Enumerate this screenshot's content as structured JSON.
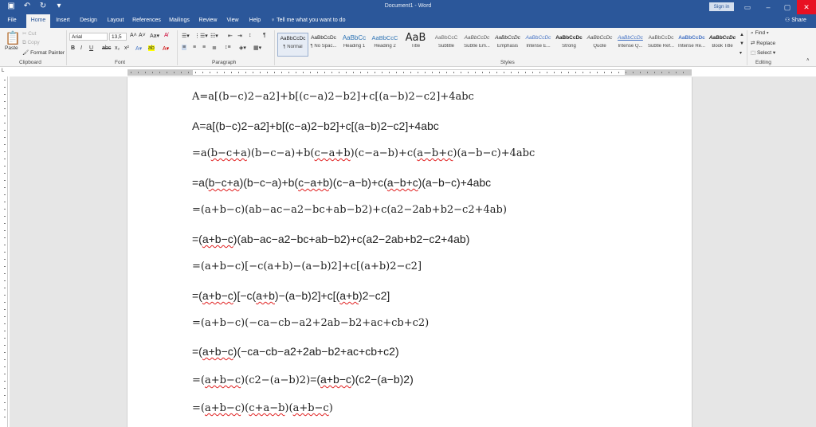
{
  "app": {
    "title": "Document1  -  Word",
    "signin": "Sign in",
    "share": "Share",
    "tell_me": "Tell me what you want to do"
  },
  "tabs": [
    "File",
    "Home",
    "Insert",
    "Design",
    "Layout",
    "References",
    "Mailings",
    "Review",
    "View",
    "Help"
  ],
  "ribbon": {
    "clipboard": {
      "label": "Clipboard",
      "paste": "Paste",
      "cut": "Cut",
      "copy": "Copy",
      "format_painter": "Format Painter"
    },
    "font": {
      "label": "Font",
      "font_name": "Arial",
      "font_size": "13,5"
    },
    "paragraph": {
      "label": "Paragraph"
    },
    "styles": {
      "label": "Styles",
      "items": [
        {
          "preview": "AaBbCcDc",
          "name": "¶ Normal"
        },
        {
          "preview": "AaBbCcDc",
          "name": "¶ No Spac..."
        },
        {
          "preview": "AaBbCc",
          "name": "Heading 1"
        },
        {
          "preview": "AaBbCcC",
          "name": "Heading 2"
        },
        {
          "preview": "AaB",
          "name": "Title"
        },
        {
          "preview": "AaBbCcC",
          "name": "Subtitle"
        },
        {
          "preview": "AaBbCcDc",
          "name": "Subtle Em..."
        },
        {
          "preview": "AaBbCcDc",
          "name": "Emphasis"
        },
        {
          "preview": "AaBbCcDc",
          "name": "Intense E..."
        },
        {
          "preview": "AaBbCcDc",
          "name": "Strong"
        },
        {
          "preview": "AaBbCcDc",
          "name": "Quote"
        },
        {
          "preview": "AaBbCcDc",
          "name": "Intense Q..."
        },
        {
          "preview": "AaBbCcDc",
          "name": "Subtle Ref..."
        },
        {
          "preview": "AaBbCcDc",
          "name": "Intense Re..."
        },
        {
          "preview": "AaBbCcDc",
          "name": "Book Title"
        }
      ]
    },
    "editing": {
      "label": "Editing",
      "find": "Find",
      "replace": "Replace",
      "select": "Select"
    }
  },
  "document": {
    "lines": [
      {
        "text": "A=a[(b−c)2−a2]+b[(c−a)2−b2]+c[(a−b)2−c2]+4abc"
      },
      {
        "text": "A=a[(b−c)2−a2]+b[(c−a)2−b2]+c[(a−b)2−c2]+4abc"
      },
      {
        "text": "=a(b−c+a)(b−c−a)+b(c−a+b)(c−a−b)+c(a−b+c)(a−b−c)+4abc"
      },
      {
        "text": "=a(b−c+a)(b−c−a)+b(c−a+b)(c−a−b)+c(a−b+c)(a−b−c)+4abc"
      },
      {
        "text": "=(a+b−c)(ab−ac−a2−bc+ab−b2)+c(a2−2ab+b2−c2+4ab)"
      },
      {
        "text": "=(a+b−c)(ab−ac−a2−bc+ab−b2)+c(a2−2ab+b2−c2+4ab)"
      },
      {
        "text": "=(a+b−c)[−c(a+b)−(a−b)2]+c[(a+b)2−c2]"
      },
      {
        "text": "=(a+b−c)[−c(a+b)−(a−b)2]+c[(a+b)2−c2]"
      },
      {
        "text": "=(a+b−c)(−ca−cb−a2+2ab−b2+ac+cb+c2)"
      },
      {
        "text": "=(a+b−c)(−ca−cb−a2+2ab−b2+ac+cb+c2)"
      },
      {
        "text": "=(a+b−c)(c2−(a−b)2)=(a+b−c)(c2−(a−b)2)"
      },
      {
        "text": "=(a+b−c)(c+a−b)(a+b−c)"
      }
    ]
  }
}
